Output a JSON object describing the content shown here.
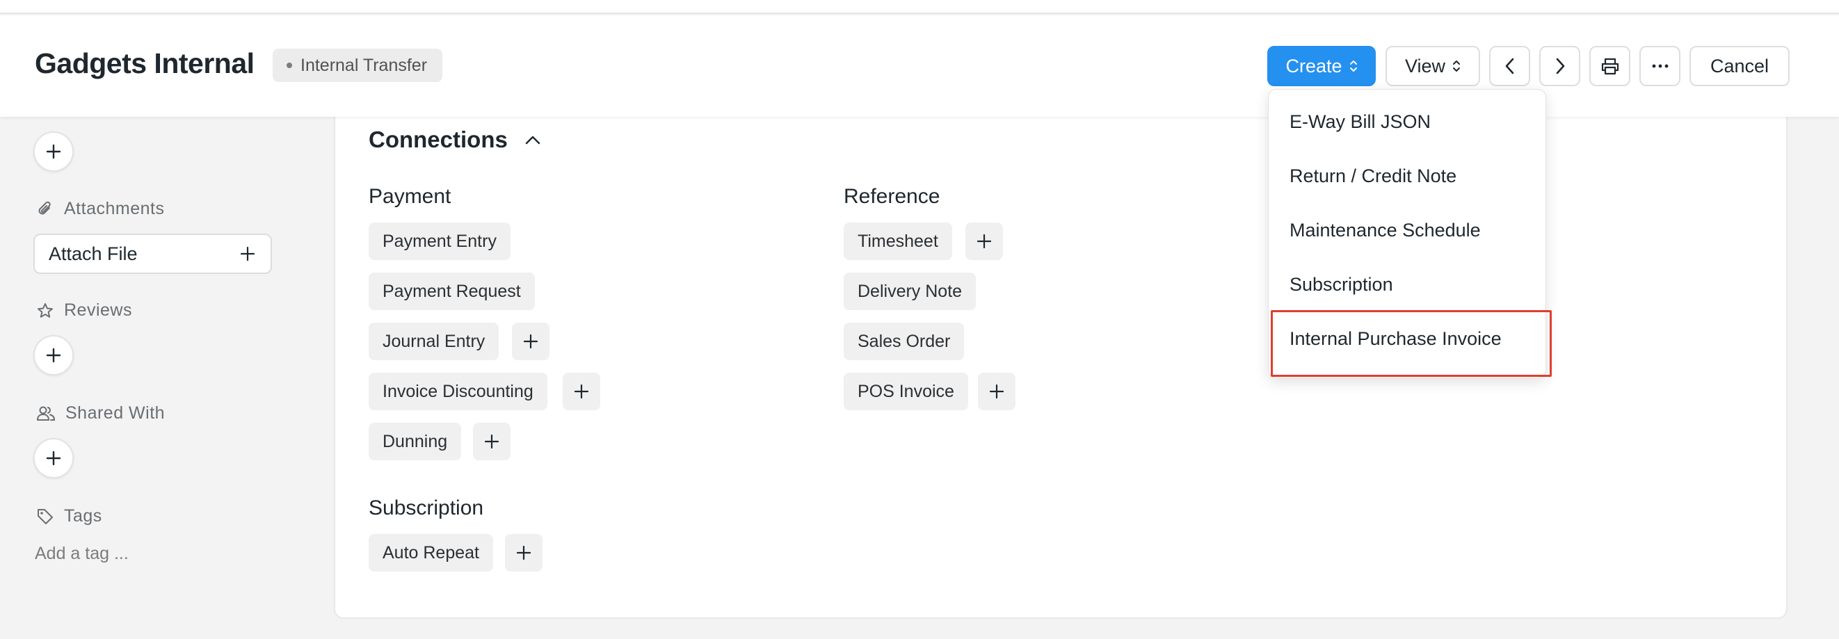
{
  "header": {
    "title": "Gadgets Internal",
    "status": "Internal Transfer",
    "buttons": {
      "create": "Create",
      "view": "View",
      "cancel": "Cancel"
    },
    "icons": [
      "chevron-left-icon",
      "chevron-right-icon",
      "printer-icon",
      "more-icon",
      "sort-updown-icon"
    ]
  },
  "sidebar": {
    "attachments": {
      "label": "Attachments",
      "button": "Attach File"
    },
    "reviews": {
      "label": "Reviews"
    },
    "shared_with": {
      "label": "Shared With"
    },
    "tags": {
      "label": "Tags",
      "placeholder": "Add a tag ..."
    }
  },
  "connections": {
    "title": "Connections",
    "groups": {
      "payment": {
        "title": "Payment",
        "items": [
          "Payment Entry",
          "Payment Request",
          "Journal Entry",
          "Invoice Discounting",
          "Dunning"
        ]
      },
      "reference": {
        "title": "Reference",
        "items": [
          "Timesheet",
          "Delivery Note",
          "Sales Order",
          "POS Invoice"
        ]
      },
      "subscription": {
        "title": "Subscription",
        "items": [
          "Auto Repeat"
        ]
      }
    }
  },
  "create_menu": {
    "items": [
      "E-Way Bill JSON",
      "Return / Credit Note",
      "Maintenance Schedule",
      "Subscription",
      "Internal Purchase Invoice"
    ],
    "highlighted": "Internal Purchase Invoice"
  },
  "colors": {
    "primary": "#2490ef",
    "highlight_border": "#e03e2d",
    "background": "#f3f3f3"
  }
}
